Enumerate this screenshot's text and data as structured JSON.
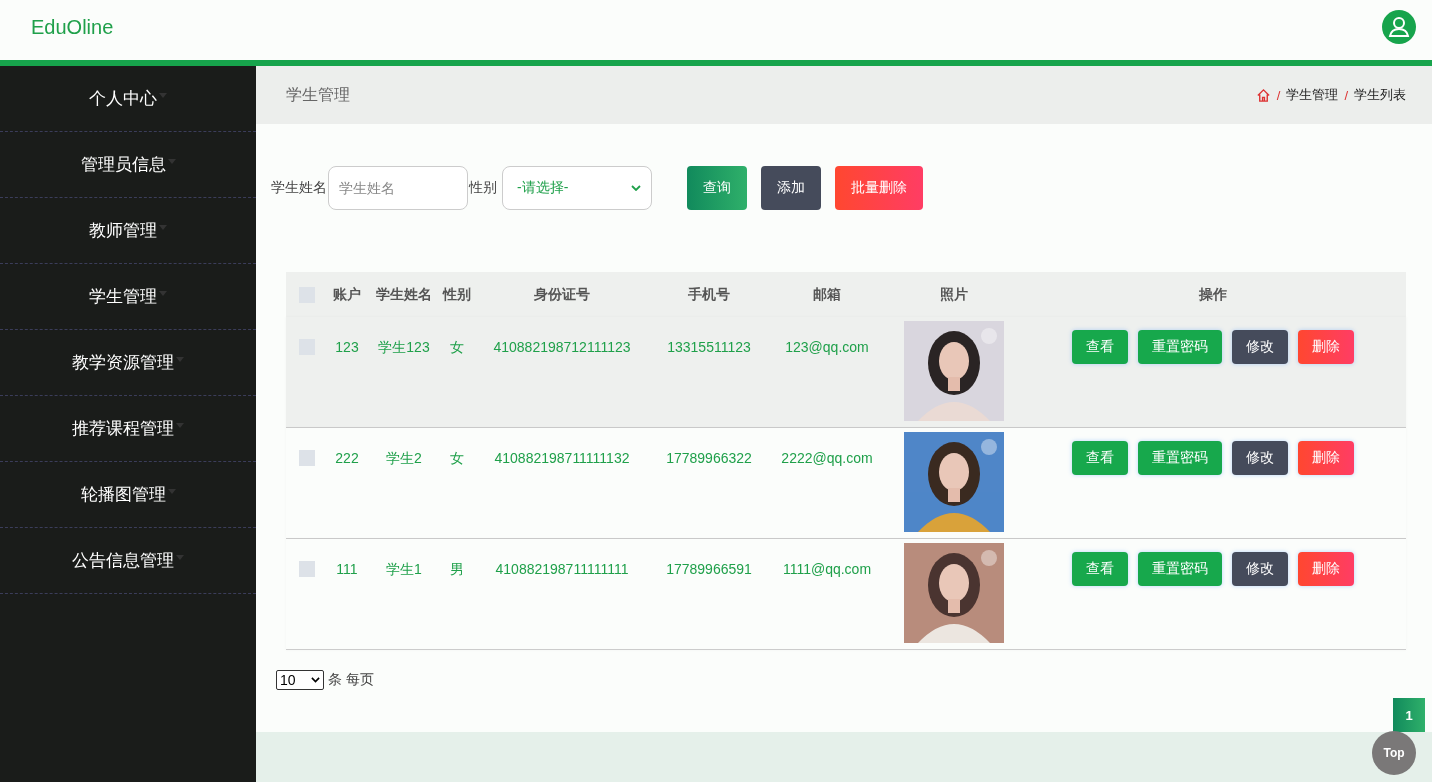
{
  "header": {
    "logo": "EduOline"
  },
  "sidebar": {
    "items": [
      {
        "label": "个人中心"
      },
      {
        "label": "管理员信息"
      },
      {
        "label": "教师管理"
      },
      {
        "label": "学生管理"
      },
      {
        "label": "教学资源管理"
      },
      {
        "label": "推荐课程管理"
      },
      {
        "label": "轮播图管理"
      },
      {
        "label": "公告信息管理"
      }
    ]
  },
  "page_title": "学生管理",
  "breadcrumb": {
    "separator": "/",
    "items": [
      "学生管理",
      "学生列表"
    ]
  },
  "search": {
    "name_label": "学生姓名",
    "name_placeholder": "学生姓名",
    "gender_label": "性别",
    "gender_value": "-请选择-",
    "buttons": [
      {
        "label": "查询",
        "kind": "query"
      },
      {
        "label": "添加",
        "kind": "add"
      },
      {
        "label": "批量删除",
        "kind": "danger"
      }
    ]
  },
  "table": {
    "select_all_checked": false,
    "columns": [
      "账户",
      "学生姓名",
      "性别",
      "身份证号",
      "手机号",
      "邮箱",
      "照片",
      "操作"
    ],
    "rows": [
      {
        "cells": [
          "123",
          "学生123",
          "女",
          "410882198712111123",
          "13315511123",
          "123@qq.com"
        ],
        "checked": false,
        "highlighted": true,
        "actions": [
          {
            "label": "查看",
            "kind": "view"
          },
          {
            "label": "重置密码",
            "kind": "view"
          },
          {
            "label": "修改",
            "kind": "edit"
          },
          {
            "label": "删除",
            "kind": "danger"
          }
        ]
      },
      {
        "cells": [
          "222",
          "学生2",
          "女",
          "410882198711111132",
          "17789966322",
          "2222@qq.com"
        ],
        "checked": false,
        "highlighted": false,
        "actions": [
          {
            "label": "查看",
            "kind": "view"
          },
          {
            "label": "重置密码",
            "kind": "view"
          },
          {
            "label": "修改",
            "kind": "edit"
          },
          {
            "label": "删除",
            "kind": "danger"
          }
        ]
      },
      {
        "cells": [
          "111",
          "学生1",
          "男",
          "410882198711111111",
          "17789966591",
          "1111@qq.com"
        ],
        "checked": false,
        "highlighted": false,
        "actions": [
          {
            "label": "查看",
            "kind": "view"
          },
          {
            "label": "重置密码",
            "kind": "view"
          },
          {
            "label": "修改",
            "kind": "edit"
          },
          {
            "label": "删除",
            "kind": "danger"
          }
        ]
      }
    ]
  },
  "pagination": {
    "page_size": "10",
    "page_size_suffix": "条 每页",
    "pages": [
      {
        "label": "1",
        "selected": true
      }
    ]
  },
  "back_to_top": "Top"
}
